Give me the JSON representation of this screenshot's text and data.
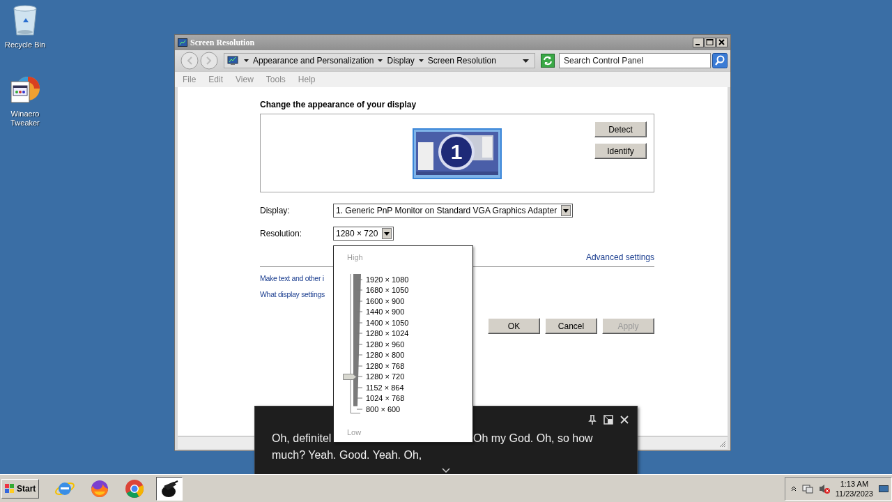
{
  "desktop_icons": [
    {
      "kind": "recycle",
      "label": "Recycle Bin"
    },
    {
      "kind": "app",
      "label": "Winaero Tweaker"
    }
  ],
  "window": {
    "title": "Screen Resolution",
    "breadcrumb": [
      "Appearance and Personalization",
      "Display",
      "Screen Resolution"
    ],
    "search": {
      "placeholder": "Search Control Panel"
    },
    "menu": [
      "File",
      "Edit",
      "View",
      "Tools",
      "Help"
    ],
    "heading": "Change the appearance of your display",
    "monitor_number": "1",
    "side_buttons": [
      "Detect",
      "Identify"
    ],
    "display": {
      "label": "Display:",
      "value": "1. Generic PnP Monitor on Standard VGA Graphics Adapter"
    },
    "resolution": {
      "label": "Resolution:",
      "value": "1280 × 720"
    },
    "advanced_link": "Advanced settings",
    "links": [
      "Make text and other i",
      "What display settings"
    ],
    "buttons": [
      {
        "label": "OK",
        "disabled": false
      },
      {
        "label": "Cancel",
        "disabled": false
      },
      {
        "label": "Apply",
        "disabled": true
      }
    ]
  },
  "resolution_popup": {
    "high": "High",
    "low": "Low",
    "options": [
      {
        "label": "1920 × 1080",
        "selected": false
      },
      {
        "label": "1680 × 1050",
        "selected": false
      },
      {
        "label": "1600 × 900",
        "selected": false
      },
      {
        "label": "1440 × 900",
        "selected": false
      },
      {
        "label": "1400 × 1050",
        "selected": false
      },
      {
        "label": "1280 × 1024",
        "selected": false
      },
      {
        "label": "1280 × 960",
        "selected": false
      },
      {
        "label": "1280 × 800",
        "selected": false
      },
      {
        "label": "1280 × 768",
        "selected": false
      },
      {
        "label": "1280 × 720",
        "selected": true
      },
      {
        "label": "1152 × 864",
        "selected": false
      },
      {
        "label": "1024 × 768",
        "selected": false
      },
      {
        "label": "800 × 600",
        "selected": false
      }
    ]
  },
  "captions": {
    "line_1_left": "Oh, definitel",
    "line_1_right": "Oh my God. Oh, so how",
    "line_2": "much? Yeah. Good. Yeah. Oh,"
  },
  "taskbar": {
    "start": "Start",
    "apps": [
      {
        "kind": "ie",
        "active": false
      },
      {
        "kind": "firefox",
        "active": false
      },
      {
        "kind": "chrome",
        "active": false
      },
      {
        "kind": "tool",
        "active": true
      }
    ],
    "time": "1:13 AM",
    "date": "11/23/2023"
  }
}
